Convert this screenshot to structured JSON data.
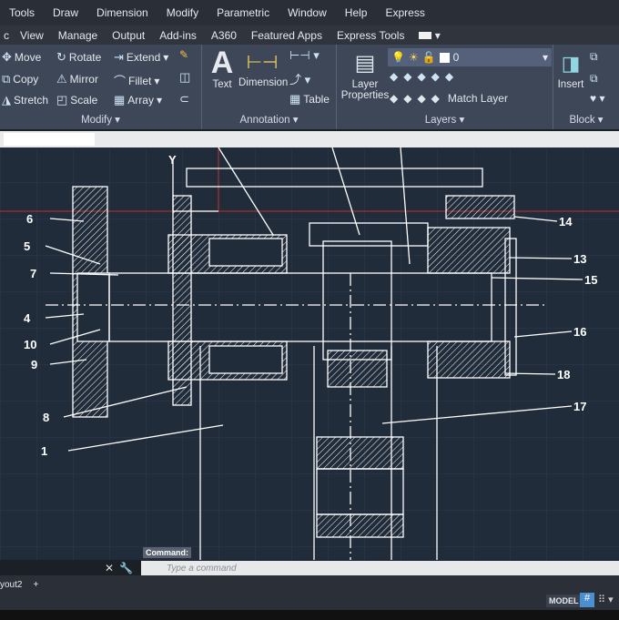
{
  "menubar": [
    "Tools",
    "Draw",
    "Dimension",
    "Modify",
    "Parametric",
    "Window",
    "Help",
    "Express"
  ],
  "tabs": [
    "c",
    "View",
    "Manage",
    "Output",
    "Add-ins",
    "A360",
    "Featured Apps",
    "Express Tools"
  ],
  "modify": {
    "move": "Move",
    "rotate": "Rotate",
    "extend": "Extend",
    "copy": "Copy",
    "mirror": "Mirror",
    "fillet": "Fillet",
    "stretch": "Stretch",
    "scale": "Scale",
    "array": "Array",
    "title": "Modify ▾"
  },
  "annotation": {
    "text": "Text",
    "dimension": "Dimension",
    "table": "Table",
    "title": "Annotation ▾"
  },
  "layers": {
    "properties_1": "Layer",
    "properties_2": "Properties",
    "current_layer": "0",
    "match": "Match Layer",
    "title": "Layers ▾"
  },
  "block": {
    "insert": "Insert",
    "title": "Block ▾"
  },
  "command": {
    "label": "Command:",
    "placeholder": "Type a command"
  },
  "layout_tab": "yout2",
  "status": {
    "model": "MODEL"
  },
  "callouts": [
    "1",
    "4",
    "5",
    "6",
    "7",
    "8",
    "9",
    "10",
    "13",
    "14",
    "15",
    "16",
    "17",
    "18"
  ],
  "axis_label": "Y"
}
